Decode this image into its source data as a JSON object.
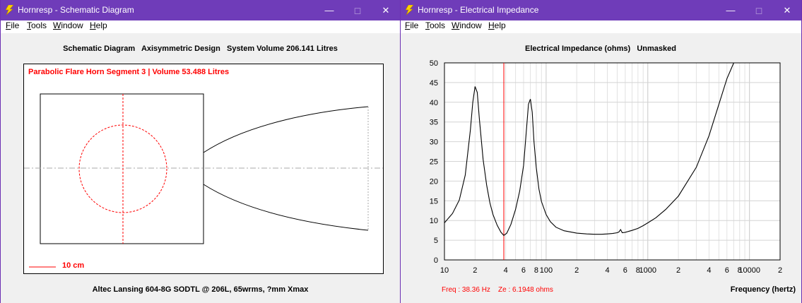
{
  "colors": {
    "titlebar": "#6f3cb9",
    "accent_red": "#ff0000"
  },
  "left_window": {
    "title": "Hornresp - Schematic Diagram",
    "menu": [
      "File",
      "Tools",
      "Window",
      "Help"
    ],
    "heading": "Schematic Diagram   Axisymmetric Design   System Volume 206.141 Litres",
    "segment_label": "Parabolic Flare Horn Segment 3 | Volume 53.488 Litres",
    "scale_label": "10 cm",
    "footer": "Altec Lansing 604-8G SODTL @ 206L, 65wrms, ?mm Xmax"
  },
  "right_window": {
    "title": "Hornresp - Electrical Impedance",
    "menu": [
      "File",
      "Tools",
      "Window",
      "Help"
    ],
    "heading": "Electrical Impedance (ohms)   Unmasked",
    "readout": "Freq : 38.36 Hz    Ze : 6.1948 ohms",
    "xlabel": "Frequency (hertz)"
  },
  "chart_data": {
    "type": "line",
    "title": "Electrical Impedance (ohms)   Unmasked",
    "xlabel": "Frequency (hertz)",
    "ylabel": "",
    "xscale": "log",
    "xlim": [
      10,
      20000
    ],
    "ylim": [
      0,
      50
    ],
    "y_ticks": [
      0,
      5,
      10,
      15,
      20,
      25,
      30,
      35,
      40,
      45,
      50
    ],
    "x_tick_labels": [
      "10",
      "2",
      "4",
      "6",
      "8",
      "100",
      "2",
      "4",
      "6",
      "8",
      "1000",
      "2",
      "4",
      "6",
      "8",
      "10000",
      "2"
    ],
    "x_tick_values": [
      10,
      20,
      40,
      60,
      80,
      100,
      200,
      400,
      600,
      800,
      1000,
      2000,
      4000,
      6000,
      8000,
      10000,
      20000
    ],
    "grid": true,
    "cursor_freq": 38.36,
    "series": [
      {
        "x": [
          10,
          12,
          14,
          16,
          18,
          19,
          20,
          21,
          22,
          24,
          26,
          28,
          30,
          33,
          36,
          38.36,
          41,
          45,
          50,
          55,
          60,
          64,
          67,
          70,
          73,
          76,
          80,
          85,
          90,
          100,
          110,
          125,
          150,
          200,
          250,
          300,
          350,
          400,
          450,
          500,
          520,
          540,
          560,
          600,
          700,
          800,
          900,
          1000,
          1200,
          1500,
          2000,
          3000,
          4000,
          5000,
          6000,
          7000
        ],
        "y": [
          9.4,
          11.8,
          15.2,
          21.5,
          33.0,
          40.0,
          44.0,
          42.5,
          36.0,
          25.5,
          19.0,
          14.5,
          11.5,
          8.8,
          7.0,
          6.2,
          6.8,
          9.0,
          12.8,
          17.5,
          24.0,
          33.0,
          39.5,
          40.8,
          37.5,
          30.0,
          23.5,
          18.0,
          14.8,
          11.5,
          9.7,
          8.3,
          7.4,
          6.8,
          6.6,
          6.5,
          6.5,
          6.6,
          6.7,
          6.9,
          7.1,
          7.7,
          6.9,
          7.0,
          7.5,
          8.0,
          8.7,
          9.4,
          10.7,
          12.8,
          16.2,
          23.5,
          31.5,
          39.5,
          46.0,
          50.0
        ]
      }
    ]
  }
}
